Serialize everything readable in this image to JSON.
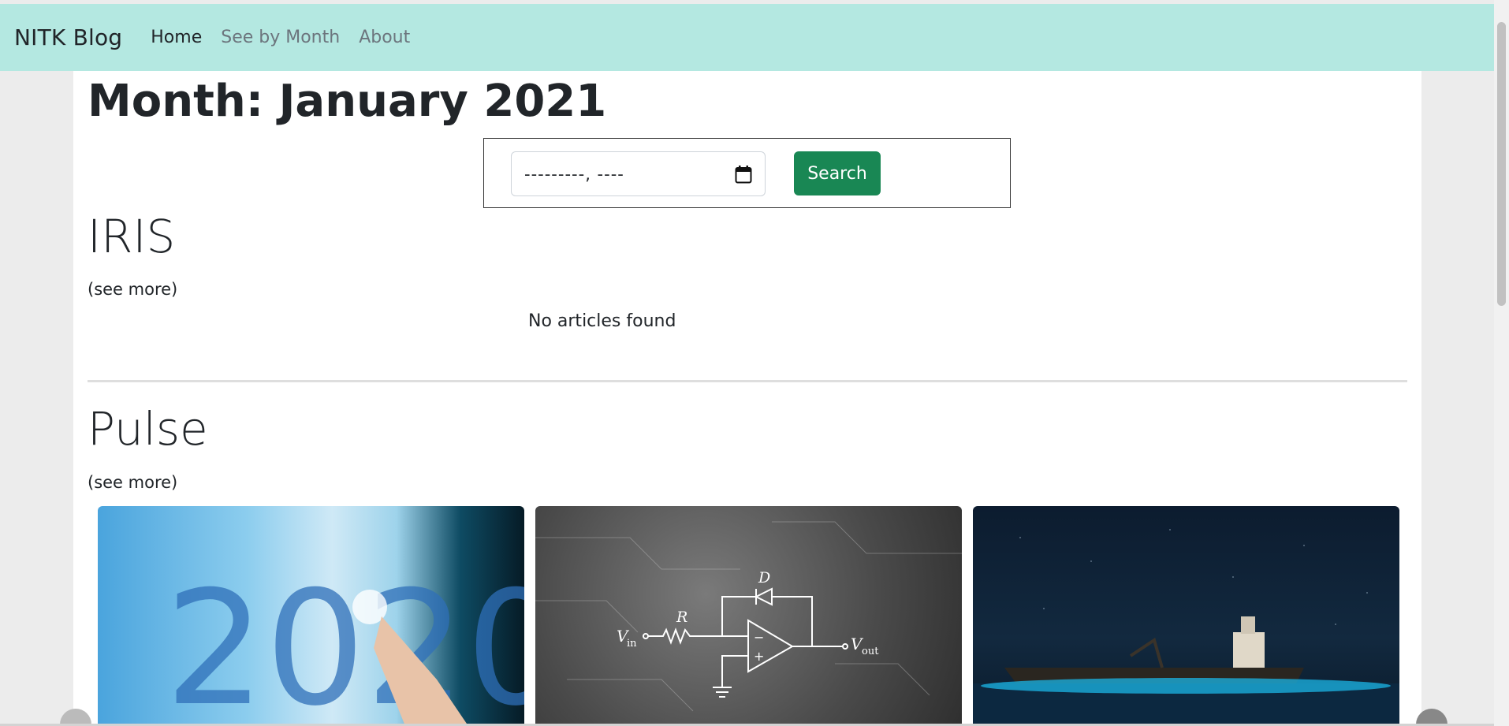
{
  "nav": {
    "brand": "NITK Blog",
    "links": [
      {
        "label": "Home",
        "active": true
      },
      {
        "label": "See by Month",
        "active": false
      },
      {
        "label": "About",
        "active": false
      }
    ]
  },
  "page": {
    "title": "Month: January 2021"
  },
  "search": {
    "date_placeholder": "---------, ----",
    "button_label": "Search"
  },
  "sections": [
    {
      "title": "IRIS",
      "see_more": "(see more)",
      "empty_message": "No articles found"
    },
    {
      "title": "Pulse",
      "see_more": "(see more)"
    }
  ],
  "colors": {
    "navbar_bg": "#b4e8e1",
    "search_button": "#198754"
  }
}
